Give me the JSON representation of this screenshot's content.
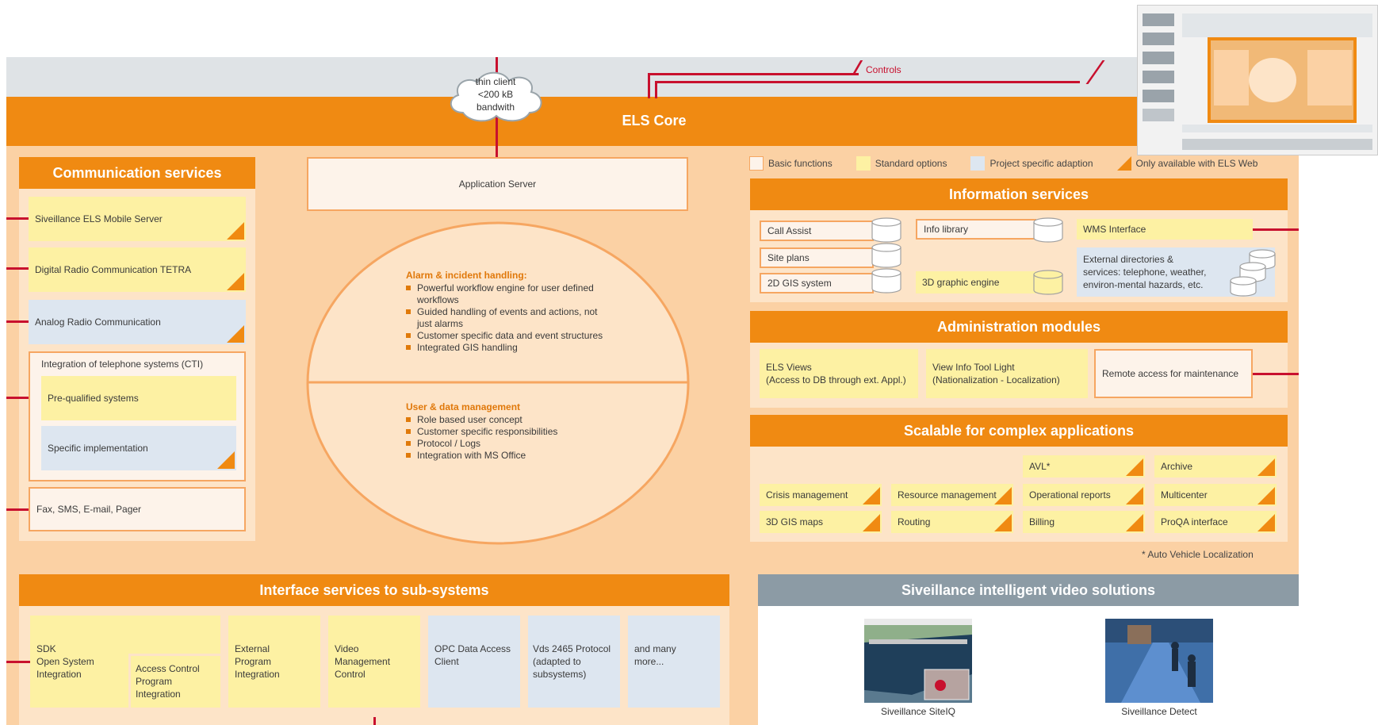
{
  "top": {
    "thin_client": "thin client\n<200 kB\nbandwith",
    "controls_label": "Controls",
    "core_title": "ELS Core"
  },
  "application_server": "Application Server",
  "legend": {
    "basic": "Basic functions",
    "standard": "Standard options",
    "project": "Project specific adaption",
    "web": "Only available with ELS Web"
  },
  "communication": {
    "title": "Communication services",
    "items": [
      "Siveillance ELS Mobile Server",
      "Digital Radio Communication TETRA",
      "Analog Radio Communication"
    ],
    "cti_title": "Integration of telephone systems (CTI)",
    "cti_items": [
      "Pre-qualified systems",
      "Specific implementation"
    ],
    "fax": "Fax, SMS, E-mail, Pager"
  },
  "circle": {
    "alarm_title": "Alarm & incident handling:",
    "alarm_items": [
      "Powerful workflow engine for user defined workflows",
      "Guided handling of events and actions, not just alarms",
      "Customer specific data and event structures",
      "Integrated GIS handling"
    ],
    "user_title": "User & data management",
    "user_items": [
      "Role based user concept",
      "Customer specific responsibilities",
      "Protocol / Logs",
      "Integration with MS Office"
    ]
  },
  "information": {
    "title": "Information services",
    "call_assist": "Call Assist",
    "site_plans": "Site plans",
    "gis_2d": "2D GIS system",
    "info_library": "Info library",
    "graphic_3d": "3D graphic engine",
    "wms": "WMS Interface",
    "external": "External directories & services: telephone, weather, environ-mental hazards, etc."
  },
  "admin": {
    "title": "Administration modules",
    "els_views": "ELS Views\n(Access to DB through ext. Appl.)",
    "view_info": "View Info Tool Light\n(Nationalization - Localization)",
    "remote": "Remote access for maintenance"
  },
  "scalable": {
    "title": "Scalable for complex applications",
    "avl": "AVL*",
    "archive": "Archive",
    "crisis": "Crisis management",
    "resource": "Resource management",
    "operational": "Operational reports",
    "multicenter": "Multicenter",
    "gis_3d": "3D GIS maps",
    "routing": "Routing",
    "billing": "Billing",
    "proqa": "ProQA interface",
    "footnote": "* Auto Vehicle Localization"
  },
  "interface": {
    "title": "Interface services to sub-systems",
    "sdk": "SDK\nOpen System\nIntegration",
    "access": "Access Control\nProgram\nIntegration",
    "external": "External\nProgram\nIntegration",
    "video": "Video\nManagement\nControl",
    "opc": "OPC Data Access\nClient",
    "vds": "Vds 2465 Protocol\n(adapted to\nsubsystems)",
    "more": "and many\nmore..."
  },
  "video": {
    "title": "Siveillance intelligent video solutions",
    "siteiq": "Siveillance SiteIQ",
    "detect": "Siveillance Detect"
  },
  "colors": {
    "orange": "#f08a12",
    "panel": "#fbd1a4",
    "yellow": "#fdf1a3",
    "blue": "#dde6f0",
    "red": "#c8102e",
    "grey_header": "#8c9ba5"
  }
}
